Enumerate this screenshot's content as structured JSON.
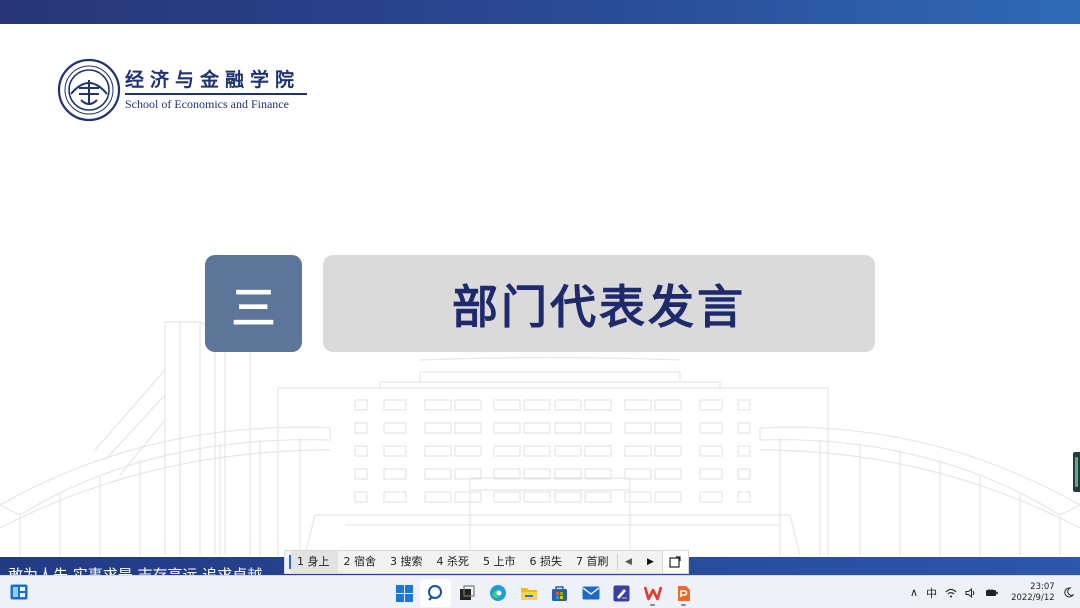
{
  "logo": {
    "name_cn": "经济与金融学院",
    "name_en": "School of Economics and Finance"
  },
  "section": {
    "number": "三",
    "title": "部门代表发言"
  },
  "ticker": {
    "text": "敢为人先   实事求是   志存高远   追求卓越"
  },
  "ime": {
    "candidates": [
      "1 身上",
      "2 宿舍",
      "3 搜索",
      "4 杀死",
      "5 上市",
      "6 损失",
      "7 首刷"
    ],
    "selected_index": 0,
    "prev_icon": "triangle-left-icon",
    "next_icon": "triangle-right-icon",
    "more_icon": "expand-candidates-icon"
  },
  "taskbar": {
    "apps": [
      "windows-start-icon",
      "search-icon",
      "task-view-icon",
      "edge-browser-icon",
      "file-explorer-icon",
      "microsoft-store-icon",
      "mail-icon",
      "pen-app-icon",
      "wps-office-icon",
      "wps-presentation-icon"
    ],
    "tray": {
      "chevron": "∧",
      "ime_mode": "中",
      "time": "23:07",
      "date": "2022/9/12"
    }
  },
  "colors": {
    "accent_navy": "#1e2a6b",
    "number_box": "#5d7599",
    "title_box": "#dadada",
    "top_band": "#273577"
  }
}
